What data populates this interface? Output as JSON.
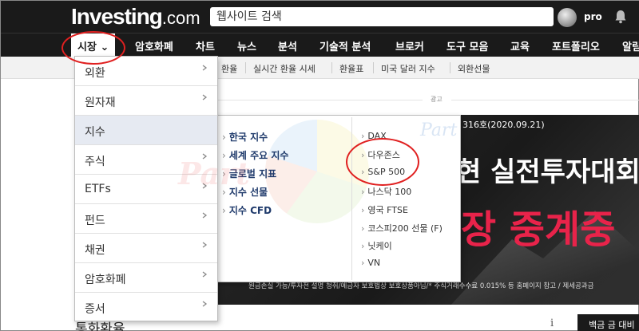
{
  "header": {
    "logo_main": "Investing",
    "logo_suffix": ".com",
    "search_placeholder": "웹사이트 검색",
    "username": "pro",
    "icons": {
      "bell": "bell-icon",
      "avatar": "avatar"
    }
  },
  "nav": {
    "items": [
      {
        "label": "시장 ⌄"
      },
      {
        "label": "암호화폐"
      },
      {
        "label": "차트"
      },
      {
        "label": "뉴스"
      },
      {
        "label": "분석"
      },
      {
        "label": "기술적 분석"
      },
      {
        "label": "브로커"
      },
      {
        "label": "도구 모음"
      },
      {
        "label": "교육"
      },
      {
        "label": "포트폴리오"
      },
      {
        "label": "알림"
      }
    ]
  },
  "subnav": {
    "items": [
      "환율",
      "실시간 환율 시세",
      "환율표",
      "미국 달러 지수",
      "외환선물"
    ]
  },
  "ad": {
    "label": "광고",
    "issue": "316호(2020.09.21)",
    "title": "현 실전투자대회",
    "red_text": "장 중계중",
    "footer": "원금손실 가능/투자전 설명 청취/예금자 보호법상 보호상품아님/* 주식거래수수료 0.015% 등 홈페이지 참고 / 제세공과금"
  },
  "markets_menu": {
    "items": [
      {
        "label": "외환"
      },
      {
        "label": "원자재"
      },
      {
        "label": "지수"
      },
      {
        "label": "주식"
      },
      {
        "label": "ETFs"
      },
      {
        "label": "펀드"
      },
      {
        "label": "채권"
      },
      {
        "label": "암호화폐"
      },
      {
        "label": "증서"
      }
    ],
    "active": "지수"
  },
  "indices_submenu": {
    "left": [
      "한국 지수",
      "세계 주요 지수",
      "글로벌 지표",
      "지수 선물",
      "지수 CFD"
    ],
    "right": [
      "DAX",
      "다우존스",
      "S&P 500",
      "나스닥 100",
      "영국 FTSE",
      "코스피200 선물 (F)",
      "닛케이",
      "VN"
    ]
  },
  "page": {
    "bottom_title": "통화환율",
    "info_icon": "i",
    "bottom_button": "백금 금 대비"
  },
  "watermark": {
    "text1": "Part",
    "text2": "Part"
  },
  "annotation_color": "#e02020"
}
